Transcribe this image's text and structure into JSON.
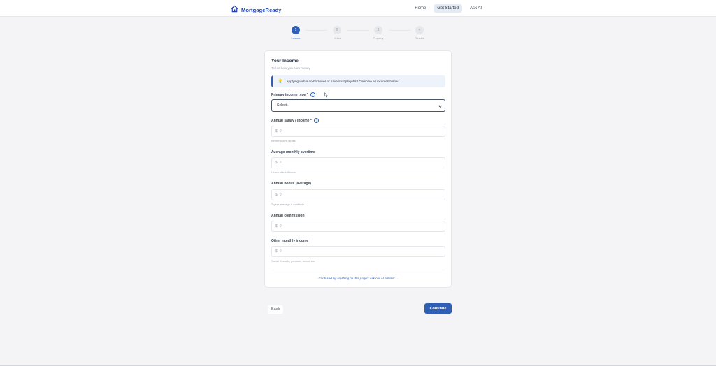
{
  "brand": {
    "name": "MortgageReady",
    "icon": "house-icon"
  },
  "nav": [
    {
      "label": "Home",
      "active": false
    },
    {
      "label": "Get Started",
      "active": true
    },
    {
      "label": "Ask AI",
      "active": false
    }
  ],
  "stepper": [
    {
      "num": "1",
      "label": "Income",
      "active": true
    },
    {
      "num": "2",
      "label": "Debts",
      "active": false
    },
    {
      "num": "3",
      "label": "Property",
      "active": false
    },
    {
      "num": "4",
      "label": "Results",
      "active": false
    }
  ],
  "card": {
    "title": "Your Income",
    "subtitle": "Tell us how you earn money",
    "info_icon": "lightbulb-icon",
    "info_text": "Applying with a co-borrower or have multiple jobs? Combine all incomes below.",
    "primary_type": {
      "label": "Primary income type *",
      "value": "Select..."
    },
    "salary": {
      "label": "Annual salary / income *",
      "currency": "$",
      "placeholder": "0",
      "hint": "Before taxes (gross)"
    },
    "overtime": {
      "label": "Average monthly overtime",
      "currency": "$",
      "placeholder": "0",
      "hint": "Leave blank if none"
    },
    "bonus": {
      "label": "Annual bonus (average)",
      "currency": "$",
      "placeholder": "0",
      "hint": "2-year average if available"
    },
    "commission": {
      "label": "Annual commission",
      "currency": "$",
      "placeholder": "0"
    },
    "other": {
      "label": "Other monthly income",
      "currency": "$",
      "placeholder": "0",
      "hint": "Social Security, pension, rental, etc."
    },
    "help_link": "Confused by anything on this page? Ask our AI advisor →"
  },
  "actions": {
    "back": "Back",
    "continue": "Continue"
  },
  "colors": {
    "primary": "#2f5fb5",
    "background": "#f4f4f6",
    "card": "#ffffff"
  }
}
